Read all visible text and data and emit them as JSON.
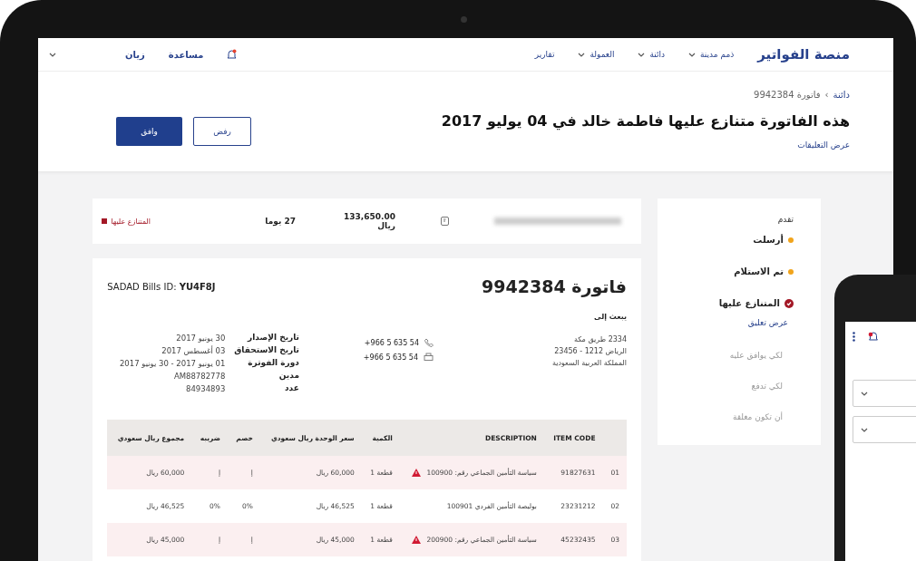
{
  "nav": {
    "logo": "منصة الفواتير",
    "items": [
      {
        "label": "ذمم مدينة",
        "dropdown": true
      },
      {
        "label": "دائنة",
        "dropdown": true
      },
      {
        "label": "العمولة",
        "dropdown": true
      },
      {
        "label": "تقارير",
        "dropdown": false
      }
    ],
    "help": "مساعدة",
    "user": "زيان"
  },
  "page_header": {
    "breadcrumb": [
      "دائنة",
      "فاتورة 9942384"
    ],
    "breadcrumb_separator": "›",
    "title": "هذه الفاتورة متنازع عليها فاطمة خالد في 04 يوليو 2017",
    "comments_link": "عرض التعليقات",
    "buttons": [
      {
        "label": "رفض",
        "kind": "secondary"
      },
      {
        "label": "وافق",
        "kind": "primary"
      }
    ]
  },
  "progress": {
    "title": "تقدم",
    "steps": [
      {
        "label": "أرسلت",
        "kind": "done"
      },
      {
        "label": "تم الاستلام",
        "kind": "done"
      },
      {
        "label": "المتنازع عليها",
        "kind": "disputed",
        "link": "عرض تعليق"
      },
      {
        "label": "لكي يوافق عليه",
        "kind": "pending"
      },
      {
        "label": "لكي تدفع",
        "kind": "pending"
      },
      {
        "label": "أن تكون مغلقة",
        "kind": "pending"
      }
    ]
  },
  "summary": {
    "amount": "133,650.00 ريال",
    "due": "27 يوما",
    "status": "المتنازع عليها"
  },
  "invoice": {
    "title": "فاتورة 9942384",
    "sadad": "SADAD Bills ID: **YU4F8J**",
    "send_to_label": "يبعث إلى",
    "address": [
      "2334 طريق مكة",
      "الرياض 1212 - 23456",
      "المملكة العربية السعودية"
    ],
    "phones": [
      {
        "kind": "phone",
        "number": "+966 5 635 54"
      },
      {
        "kind": "fax",
        "number": "+966 5 635 54"
      }
    ],
    "details": [
      {
        "label": "تاريخ الإصدار",
        "value": "30 يونيو 2017"
      },
      {
        "label": "تاريخ الاستحقاق",
        "value": "03 أغسطس 2017"
      },
      {
        "label": "دورة الفوترة",
        "value": "01 يونيو 2017 - 30 يونيو 2017"
      },
      {
        "label": "مدين",
        "value": "AM88782778"
      },
      {
        "label": "عدد",
        "value": "84934893"
      }
    ]
  },
  "table": {
    "columns": [
      "ITEM CODE",
      "DESCRIPTION",
      "الكمية",
      "سعر الوحدة ريال سعودي",
      "خصم",
      "ضريبه",
      "مجموع ريال سعودي"
    ],
    "rows": [
      {
        "number": "01",
        "flagged": true,
        "cells": [
          "91827631",
          "سياسة التأمين الجماعي رقم: 100900",
          "قطعة 1",
          "60,000 ريال",
          "إ",
          "إ",
          "60,000 ريال"
        ]
      },
      {
        "number": "02",
        "flagged": false,
        "cells": [
          "23231212",
          "بوليصة التأمين الفردي 100901",
          "قطعة 1",
          "46,525 ريال",
          "0%",
          "0%",
          "46,525 ريال"
        ]
      },
      {
        "number": "03",
        "flagged": true,
        "cells": [
          "45232435",
          "سياسة التأمين الجماعي رقم: 200900",
          "قطعة 1",
          "45,000 ريال",
          "إ",
          "إ",
          "45,000 ريال"
        ]
      }
    ]
  }
}
